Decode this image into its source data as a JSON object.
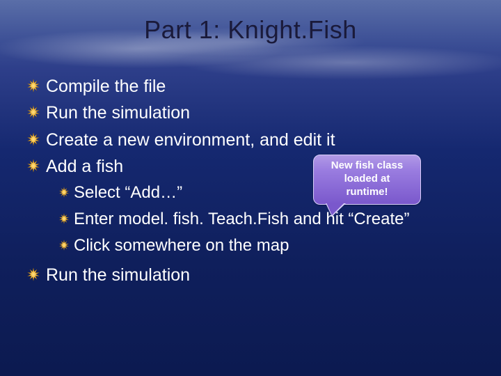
{
  "title": "Part 1: Knight.Fish",
  "bullets": [
    {
      "text": "Compile the file"
    },
    {
      "text": "Run the simulation"
    },
    {
      "text": "Create a new environment, and edit it"
    },
    {
      "text": "Add a fish",
      "children": [
        {
          "text": "Select “Add…”"
        },
        {
          "text": "Enter model. fish. Teach.Fish and hit “Create”"
        },
        {
          "text": "Click somewhere on the map"
        }
      ]
    },
    {
      "text": "Run the simulation"
    }
  ],
  "callout": {
    "line1": "New fish class",
    "line2": "loaded at",
    "line3": "runtime!"
  },
  "colors": {
    "bullet_primary": "#f2b634",
    "bullet_secondary": "#d9a226"
  }
}
